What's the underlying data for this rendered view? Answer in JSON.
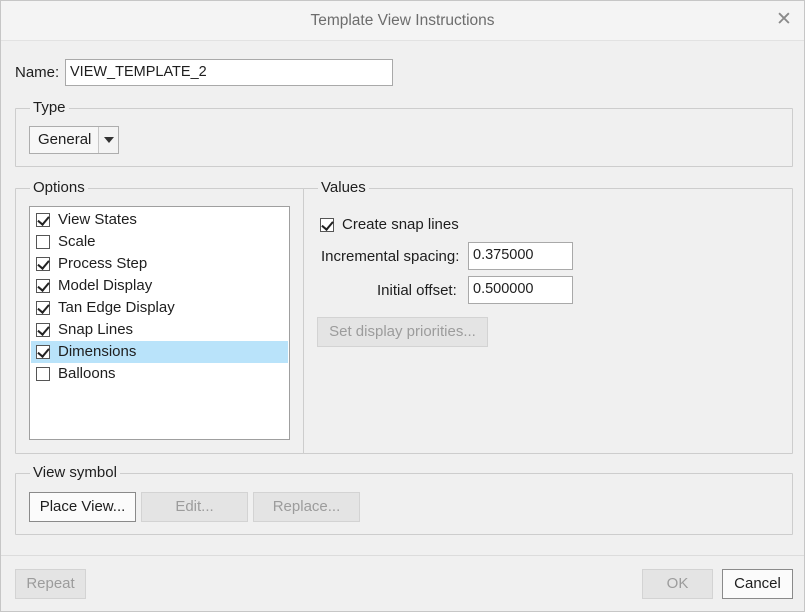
{
  "dialog": {
    "title": "Template View Instructions",
    "close_glyph": "✕"
  },
  "name_field": {
    "label": "Name:",
    "value": "VIEW_TEMPLATE_2"
  },
  "type_group": {
    "legend": "Type",
    "selected": "General"
  },
  "options_group": {
    "legend": "Options",
    "items": [
      {
        "label": "View States",
        "checked": true,
        "selected": false
      },
      {
        "label": "Scale",
        "checked": false,
        "selected": false
      },
      {
        "label": "Process Step",
        "checked": true,
        "selected": false
      },
      {
        "label": "Model Display",
        "checked": true,
        "selected": false
      },
      {
        "label": "Tan Edge Display",
        "checked": true,
        "selected": false
      },
      {
        "label": "Snap Lines",
        "checked": true,
        "selected": false
      },
      {
        "label": "Dimensions",
        "checked": true,
        "selected": true
      },
      {
        "label": "Balloons",
        "checked": false,
        "selected": false
      }
    ]
  },
  "values_group": {
    "legend": "Values",
    "create_snap_lines_label": "Create snap lines",
    "create_snap_lines_checked": true,
    "incremental_spacing_label": "Incremental spacing:",
    "incremental_spacing_value": "0.375000",
    "initial_offset_label": "Initial offset:",
    "initial_offset_value": "0.500000",
    "set_display_priorities_label": "Set display priorities..."
  },
  "view_symbol_group": {
    "legend": "View symbol",
    "place_view_label": "Place View...",
    "edit_label": "Edit...",
    "replace_label": "Replace..."
  },
  "footer": {
    "repeat_label": "Repeat",
    "ok_label": "OK",
    "cancel_label": "Cancel"
  },
  "colors": {
    "selection_highlight": "#b9e3fa",
    "dialog_background": "#f0f0f0",
    "disabled_text": "#9c9c9c"
  }
}
